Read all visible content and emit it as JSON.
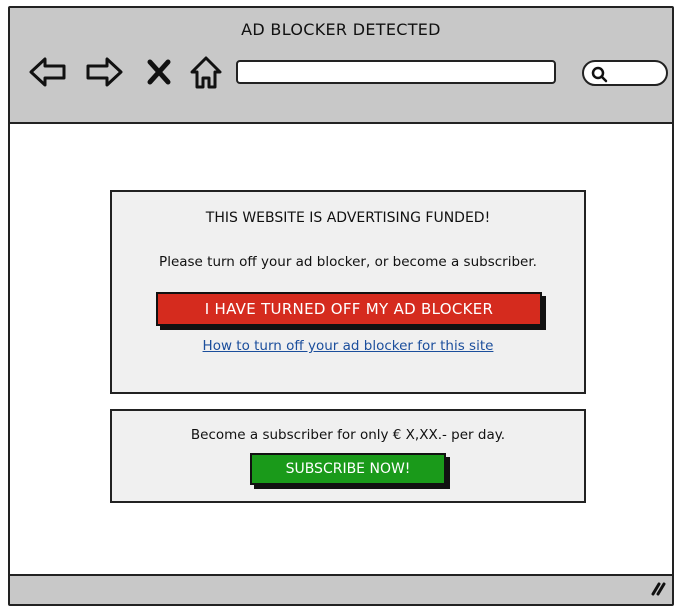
{
  "window": {
    "title": "AD BLOCKER DETECTED",
    "icons": [
      "back-arrow-icon",
      "forward-arrow-icon",
      "close-x-icon",
      "home-icon",
      "search-icon",
      "resize-grip-icon"
    ]
  },
  "address_bar": {
    "value": ""
  },
  "notice": {
    "title": "THIS WEBSITE IS ADVERTISING FUNDED!",
    "message": "Please turn off your ad blocker, or become a subscriber.",
    "disabled_button": "I HAVE TURNED OFF MY AD BLOCKER",
    "help_link": "How to turn off your ad blocker for this site"
  },
  "subscribe": {
    "offer": "Become a subscriber for only € X,XX.- per day.",
    "button": "SUBSCRIBE NOW!"
  },
  "colors": {
    "chrome": "#c8c8c8",
    "panel": "#f0f0f0",
    "red_button": "#d52b1e",
    "green_button": "#1a9a1a",
    "link": "#1b4e9c"
  }
}
